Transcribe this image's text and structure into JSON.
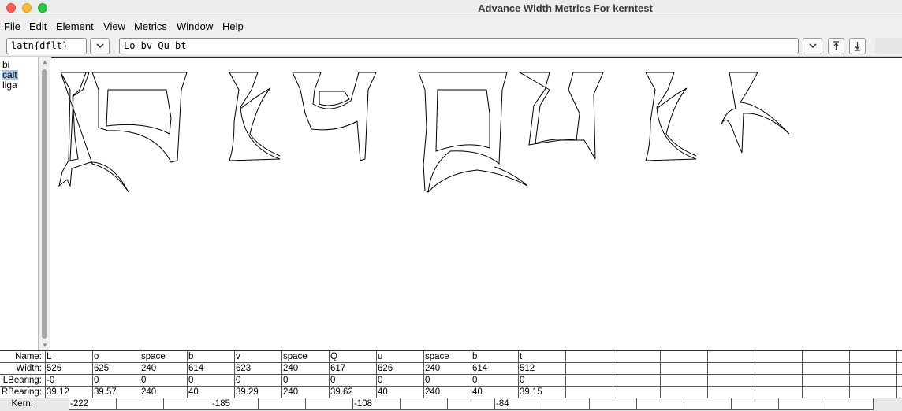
{
  "window": {
    "title": "Advance Width Metrics For kerntest"
  },
  "menu": [
    {
      "label": "File",
      "underline": "F",
      "rest": "ile"
    },
    {
      "label": "Edit",
      "underline": "E",
      "rest": "dit"
    },
    {
      "label": "Element",
      "underline": "E",
      "rest": "lement"
    },
    {
      "label": "View",
      "underline": "V",
      "rest": "iew"
    },
    {
      "label": "Metrics",
      "underline": "M",
      "rest": "etrics"
    },
    {
      "label": "Window",
      "underline": "W",
      "rest": "indow"
    },
    {
      "label": "Help",
      "underline": "H",
      "rest": "elp"
    }
  ],
  "toolbar": {
    "script_value": "latn{dflt}",
    "text_value": "Lo bv Qu bt"
  },
  "features": [
    {
      "label": "bi",
      "selected": false
    },
    {
      "label": "calt",
      "selected": true
    },
    {
      "label": "liga",
      "selected": false
    }
  ],
  "metrics": {
    "labels": {
      "name": "Name:",
      "width": "Width:",
      "lbearing": "LBearing:",
      "rbearing": "RBearing:",
      "kern": "Kern:"
    },
    "glyphs": [
      {
        "name": "L",
        "width": "526",
        "lbearing": "-0",
        "rbearing": "39.12"
      },
      {
        "name": "o",
        "width": "625",
        "lbearing": "0",
        "rbearing": "39.57"
      },
      {
        "name": "space",
        "width": "240",
        "lbearing": "0",
        "rbearing": "240"
      },
      {
        "name": "b",
        "width": "614",
        "lbearing": "0",
        "rbearing": "40"
      },
      {
        "name": "v",
        "width": "623",
        "lbearing": "0",
        "rbearing": "39.29"
      },
      {
        "name": "space",
        "width": "240",
        "lbearing": "0",
        "rbearing": "240"
      },
      {
        "name": "Q",
        "width": "617",
        "lbearing": "0",
        "rbearing": "39.62"
      },
      {
        "name": "u",
        "width": "626",
        "lbearing": "0",
        "rbearing": "40"
      },
      {
        "name": "space",
        "width": "240",
        "lbearing": "0",
        "rbearing": "240"
      },
      {
        "name": "b",
        "width": "614",
        "lbearing": "0",
        "rbearing": "40"
      },
      {
        "name": "t",
        "width": "512",
        "lbearing": "0",
        "rbearing": "39.15"
      }
    ],
    "kern": [
      "-222",
      "",
      "",
      "-185",
      "",
      "",
      "-108",
      "",
      "",
      "-84"
    ]
  }
}
